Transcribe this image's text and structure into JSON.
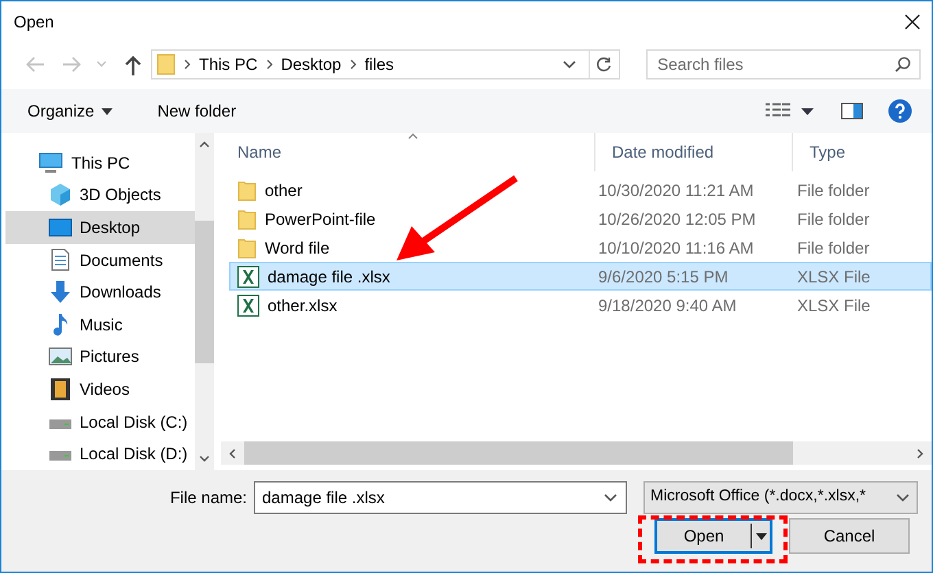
{
  "window": {
    "title": "Open"
  },
  "nav": [
    {
      "kind": "back",
      "disabled": true
    },
    {
      "kind": "forward",
      "disabled": true
    },
    {
      "kind": "recent",
      "disabled": true
    },
    {
      "kind": "up",
      "disabled": false
    }
  ],
  "address": {
    "path": [
      "This PC",
      "Desktop",
      "files"
    ]
  },
  "search": {
    "placeholder": "Search files"
  },
  "toolbar": {
    "buttons": [
      "Organize",
      "New folder"
    ]
  },
  "sidebar": {
    "items": [
      {
        "label": "This PC",
        "kind": "pc",
        "selected": false,
        "children": [
          {
            "label": "3D Objects",
            "kind": "cube",
            "selected": false
          },
          {
            "label": "Desktop",
            "kind": "desktop",
            "selected": true
          },
          {
            "label": "Documents",
            "kind": "document",
            "selected": false
          },
          {
            "label": "Downloads",
            "kind": "download",
            "selected": false
          },
          {
            "label": "Music",
            "kind": "music",
            "selected": false
          },
          {
            "label": "Pictures",
            "kind": "pictures",
            "selected": false
          },
          {
            "label": "Videos",
            "kind": "videos",
            "selected": false
          },
          {
            "label": "Local Disk (C:)",
            "kind": "drive",
            "selected": false
          },
          {
            "label": "Local Disk (D:)",
            "kind": "drive",
            "selected": false
          }
        ]
      }
    ]
  },
  "table": {
    "columns": [
      "Name",
      "Date modified",
      "Type"
    ],
    "rows": [
      {
        "name": "other",
        "date": "10/30/2020 11:21 AM",
        "type": "File folder",
        "kind": "folder",
        "selected": false
      },
      {
        "name": "PowerPoint-file",
        "date": "10/26/2020 12:05 PM",
        "type": "File folder",
        "kind": "folder",
        "selected": false
      },
      {
        "name": "Word file",
        "date": "10/10/2020 11:16 AM",
        "type": "File folder",
        "kind": "folder",
        "selected": false
      },
      {
        "name": "damage file .xlsx",
        "date": "9/6/2020 5:15 PM",
        "type": "XLSX File",
        "kind": "xlsx",
        "selected": true
      },
      {
        "name": "other.xlsx",
        "date": "9/18/2020 9:40 AM",
        "type": "XLSX File",
        "kind": "xlsx",
        "selected": false
      }
    ]
  },
  "footer": {
    "file_name_label": "File name:",
    "file_name": "damage file .xlsx",
    "filter": "Microsoft Office (*.docx,*.xlsx,*",
    "buttons": [
      {
        "label": "Open",
        "kind": "split",
        "focused": true
      },
      {
        "label": "Cancel",
        "kind": "plain",
        "focused": false
      }
    ]
  }
}
